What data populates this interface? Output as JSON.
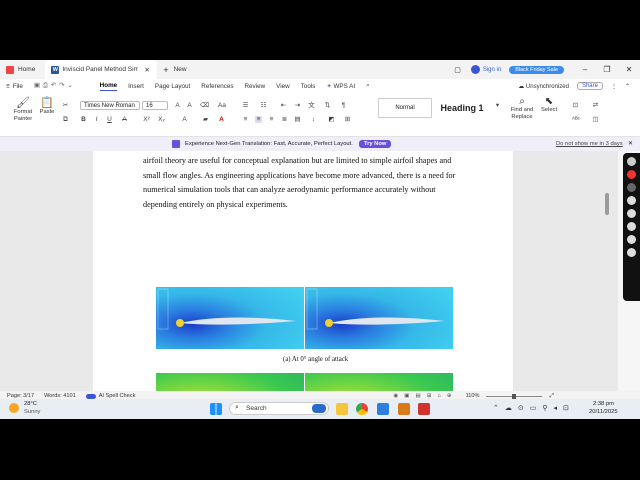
{
  "titlebar": {
    "home_tab": "Home",
    "doc_tab": "Inviscid Panel Method Simu",
    "new_tab": "New",
    "sign_in": "Sign in",
    "black_friday": "Black Friday Sale"
  },
  "menu": {
    "file": "File",
    "items": [
      "Home",
      "Insert",
      "Page Layout",
      "References",
      "Review",
      "View",
      "Tools",
      "WPS AI"
    ],
    "unsync": "Unsynchronized",
    "share": "Share"
  },
  "ribbon": {
    "format_painter": "Format Painter",
    "paste": "Paste",
    "font": "Times New Roman",
    "size": "16",
    "style_normal": "Normal",
    "style_heading": "Heading 1",
    "find_replace": "Find and Replace",
    "select": "Select"
  },
  "promo": {
    "text": "Experience Next-Gen Translation: Fast, Accurate, Perfect Layout.",
    "button": "Try Now",
    "dismiss": "Do not show me in 3 days"
  },
  "document": {
    "lines": [
      "airfoil theory are useful for conceptual explanation but are limited to simple airfoil shapes and",
      "small flow angles. As engineering applications have become more advanced, there is a need for",
      "numerical simulation tools that can analyze aerodynamic performance accurately without",
      "depending entirely on physical experiments."
    ],
    "caption_a": "(a)  At 0° angle of attack"
  },
  "status": {
    "page": "Page: 3/17",
    "words": "Words: 4101",
    "spell": "AI Spell Check",
    "zoom": "110%"
  },
  "taskbar": {
    "temp": "28°C",
    "weather": "Sunny",
    "search": "Search",
    "time": "2:38 pm",
    "date": "20/11/2025"
  },
  "colors": {
    "accent": "#3a56d4",
    "promo_button": "#6b4fd8",
    "black_friday": "#3b8cf0"
  }
}
